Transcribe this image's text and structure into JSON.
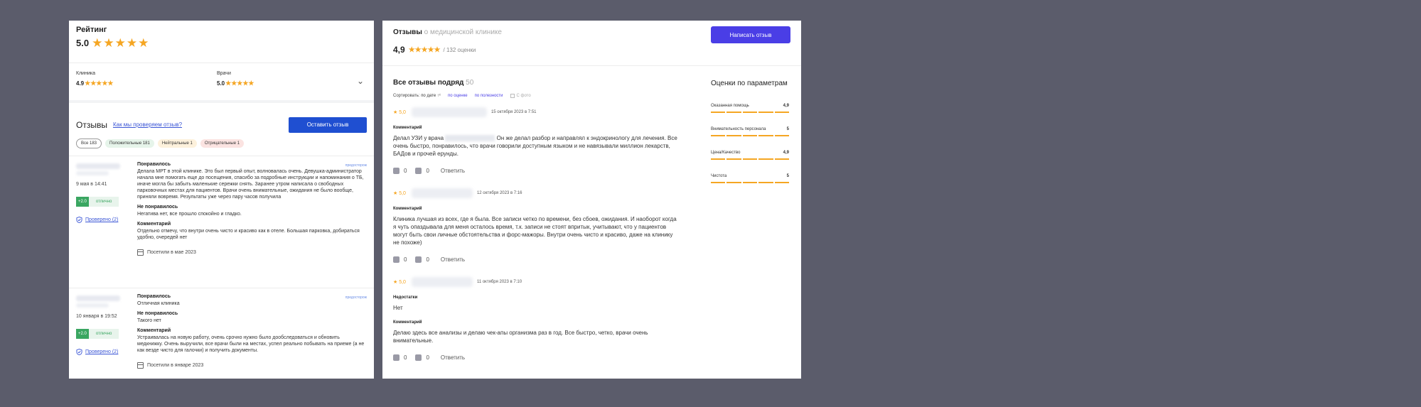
{
  "left": {
    "rating": {
      "title": "Рейтинг",
      "value": "5.0",
      "stars": 5
    },
    "sub_ratings": [
      {
        "label": "Клиника",
        "value": "4.9"
      },
      {
        "label": "Врачи",
        "value": "5.0"
      }
    ],
    "reviews_header": {
      "title": "Отзывы",
      "check_link": "Как мы проверяем отзыв?",
      "leave_button": "Оставить отзыв"
    },
    "filters": [
      "Все 183",
      "Положительные 181",
      "Нейтральные 1",
      "Отрицательные 1"
    ],
    "reviews": [
      {
        "date": "9 мая в 14:41",
        "score": "+2.0",
        "score_label": "отлично",
        "verified": "Проверено (2)",
        "predicted": "предосторож",
        "sections": [
          {
            "title": "Понравилось",
            "text": "Делала МРТ в этой клинике. Это был первый опыт, волновалась очень. Девушка-администратор начала мне помогать еще до посещения, спасибо за подробные инструкции и напоминания о ТБ, иначе могла бы забыть маленькие сережки снять. Заранее утром написала о свободных парковочных местах для пациентов. Врачи очень внимательные, ожидания не было вообще, приняли вовремя. Результаты уже через пару часов получила"
          },
          {
            "title": "Не понравилось",
            "text": "Негатива нет, все прошло спокойно и гладко."
          },
          {
            "title": "Комментарий",
            "text": "Отдельно отмечу, что внутри очень чисто и красиво как в отеле. Большая парковка, добираться удобно, очередей нет"
          }
        ],
        "visited": "Посетили в мае 2023"
      },
      {
        "date": "10 января в 19:52",
        "score": "+2.0",
        "score_label": "отлично",
        "verified": "Проверено (2)",
        "predicted": "предосторож",
        "sections": [
          {
            "title": "Понравилось",
            "text": "Отличная клиника"
          },
          {
            "title": "Не понравилось",
            "text": "Такого нет"
          },
          {
            "title": "Комментарий",
            "text": "Устраивалась на новую работу, очень срочно нужно было дообследоваться и обновить медкнижку. Очень выручили, все врачи были на местах, успел реально побывать на приеме (а не как везде чисто для галочки) и получить документы."
          }
        ],
        "visited": "Посетили в январе 2023"
      }
    ]
  },
  "right": {
    "header": {
      "title": "Отзывы",
      "title_muted": "о медицинской клинике",
      "rating": "4,9",
      "count": "/ 132 оценки",
      "write_button": "Написать отзыв"
    },
    "all": {
      "title": "Все отзывы подряд",
      "count": "50"
    },
    "sort": {
      "label": "Сортировать:",
      "by_date": "по дате",
      "by_rating": "по оценке",
      "by_usefulness": "по полезности",
      "photo": "С фото"
    },
    "reviews": [
      {
        "score": "★ 5,0",
        "date": "15 октября 2023 в 7:51",
        "sections": [
          {
            "title": "Комментарий",
            "text_before": "Делал УЗИ у врача",
            "text_after": "Он же делал разбор и направлял к эндокринологу для лечения. Все очень быстро, понравилось, что врачи говорили доступным языком и не навязывали миллион лекарств, БАДов и прочей ерунды."
          }
        ],
        "likes": "0",
        "dislikes": "0",
        "reply": "Ответить"
      },
      {
        "score": "★ 5,0",
        "date": "12 октября 2023 в 7:16",
        "sections": [
          {
            "title": "Комментарий",
            "text": "Клиника лучшая из всех, где я была. Все записи четко по времени, без сбоев, ожидания. И наоборот когда я чуть опаздывала для меня осталось время, т.к. записи не стоят впритык, учитывают, что у пациентов могут быть свои личные обстоятельства и форс-мажоры. Внутри очень чисто и красиво, даже на клинику не похоже)"
          }
        ],
        "likes": "0",
        "dislikes": "0",
        "reply": "Ответить"
      },
      {
        "score": "★ 5,0",
        "date": "11 октября 2023 в 7:10",
        "sections": [
          {
            "title": "Недостатки",
            "text": "Нет"
          },
          {
            "title": "Комментарий",
            "text": "Делаю здесь все анализы и делаю чек-апы организма раз в год. Все быстро, четко, врачи очень внимательные."
          }
        ],
        "likes": "0",
        "dislikes": "0",
        "reply": "Ответить"
      }
    ],
    "params": {
      "title": "Оценки по параметрам",
      "items": [
        {
          "label": "Оказанная помощь",
          "value": "4,9"
        },
        {
          "label": "Внимательность персонала",
          "value": "5"
        },
        {
          "label": "Цена/Качество",
          "value": "4,9"
        },
        {
          "label": "Чистота",
          "value": "5"
        }
      ]
    }
  },
  "colors": {
    "background": "#5b5c6b",
    "star": "#f5a623",
    "primary_blue": "#1f4fd1",
    "violet": "#4a3ee6",
    "positive_green": "#3aa661"
  }
}
